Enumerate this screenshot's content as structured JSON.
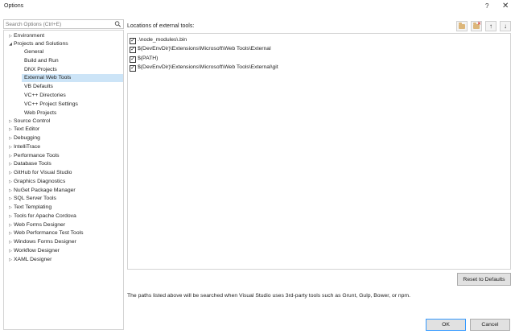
{
  "window": {
    "title": "Options",
    "help_glyph": "?",
    "close_glyph": "✕"
  },
  "search": {
    "placeholder": "Search Options (Ctrl+E)",
    "icon": "search-icon"
  },
  "tree": {
    "items": [
      {
        "label": "Environment",
        "arrow": "▷"
      },
      {
        "label": "Projects and Solutions",
        "arrow": "◢"
      },
      {
        "label": "General",
        "arrow": ""
      },
      {
        "label": "Build and Run",
        "arrow": ""
      },
      {
        "label": "DNX Projects",
        "arrow": ""
      },
      {
        "label": "External Web Tools",
        "arrow": "",
        "selected": true
      },
      {
        "label": "VB Defaults",
        "arrow": ""
      },
      {
        "label": "VC++ Directories",
        "arrow": ""
      },
      {
        "label": "VC++ Project Settings",
        "arrow": ""
      },
      {
        "label": "Web Projects",
        "arrow": ""
      },
      {
        "label": "Source Control",
        "arrow": "▷"
      },
      {
        "label": "Text Editor",
        "arrow": "▷"
      },
      {
        "label": "Debugging",
        "arrow": "▷"
      },
      {
        "label": "IntelliTrace",
        "arrow": "▷"
      },
      {
        "label": "Performance Tools",
        "arrow": "▷"
      },
      {
        "label": "Database Tools",
        "arrow": "▷"
      },
      {
        "label": "GitHub for Visual Studio",
        "arrow": "▷"
      },
      {
        "label": "Graphics Diagnostics",
        "arrow": "▷"
      },
      {
        "label": "NuGet Package Manager",
        "arrow": "▷"
      },
      {
        "label": "SQL Server Tools",
        "arrow": "▷"
      },
      {
        "label": "Text Templating",
        "arrow": "▷"
      },
      {
        "label": "Tools for Apache Cordova",
        "arrow": "▷"
      },
      {
        "label": "Web Forms Designer",
        "arrow": "▷"
      },
      {
        "label": "Web Performance Test Tools",
        "arrow": "▷"
      },
      {
        "label": "Windows Forms Designer",
        "arrow": "▷"
      },
      {
        "label": "Workflow Designer",
        "arrow": "▷"
      },
      {
        "label": "XAML Designer",
        "arrow": "▷"
      }
    ]
  },
  "panel": {
    "label": "Locations of external tools:",
    "toolbar": {
      "add_icon": "add-folder-icon",
      "remove_icon": "remove-folder-icon",
      "up_glyph": "↑",
      "down_glyph": "↓",
      "badge_glyph": "✕"
    },
    "paths": [
      {
        "text": ".\\node_modules\\.bin",
        "checked": true
      },
      {
        "text": "$(DevEnvDir)\\Extensions\\Microsoft\\Web Tools\\External",
        "checked": true
      },
      {
        "text": "$(PATH)",
        "checked": true
      },
      {
        "text": "$(DevEnvDir)\\Extensions\\Microsoft\\Web Tools\\External\\git",
        "checked": true
      }
    ],
    "check_glyph": "✓",
    "reset_label": "Reset to Defaults",
    "info_text": "The paths listed above will be searched when Visual Studio uses 3rd-party tools such as Grunt, Gulp, Bower, or npm."
  },
  "footer": {
    "ok_label": "OK",
    "cancel_label": "Cancel"
  }
}
